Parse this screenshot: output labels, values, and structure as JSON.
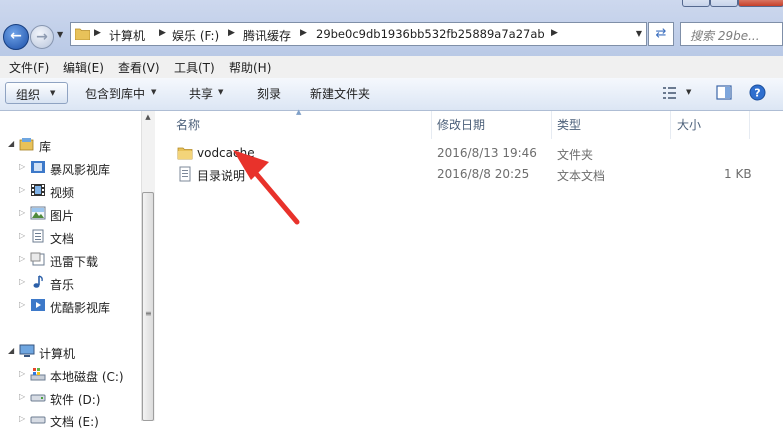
{
  "address_bar": {
    "breadcrumbs": [
      "计算机",
      "娱乐 (F:)",
      "腾讯缓存",
      "29be0c9db1936bb532fb25889a7a27ab"
    ],
    "search_placeholder": "搜索 29be..."
  },
  "menu": [
    "文件(F)",
    "编辑(E)",
    "查看(V)",
    "工具(T)",
    "帮助(H)"
  ],
  "toolbar": {
    "organize": "组织",
    "include_in_library": "包含到库中",
    "share": "共享",
    "burn": "刻录",
    "new_folder": "新建文件夹"
  },
  "nav_tree": {
    "libraries_label": "库",
    "libraries": [
      "暴风影视库",
      "视频",
      "图片",
      "文档",
      "迅雷下载",
      "音乐",
      "优酷影视库"
    ],
    "computer_label": "计算机",
    "drives": [
      "本地磁盘 (C:)",
      "软件 (D:)",
      "文档 (E:)"
    ]
  },
  "columns": {
    "name": "名称",
    "date": "修改日期",
    "type": "类型",
    "size": "大小"
  },
  "files": [
    {
      "name": "vodcache",
      "date": "2016/8/13 19:46",
      "type": "文件夹",
      "size": "",
      "icon": "folder-icon"
    },
    {
      "name": "目录说明",
      "date": "2016/8/8 20:25",
      "type": "文本文档",
      "size": "1 KB",
      "icon": "text-file-icon"
    }
  ],
  "annotation": {
    "color": "#e8322b"
  }
}
